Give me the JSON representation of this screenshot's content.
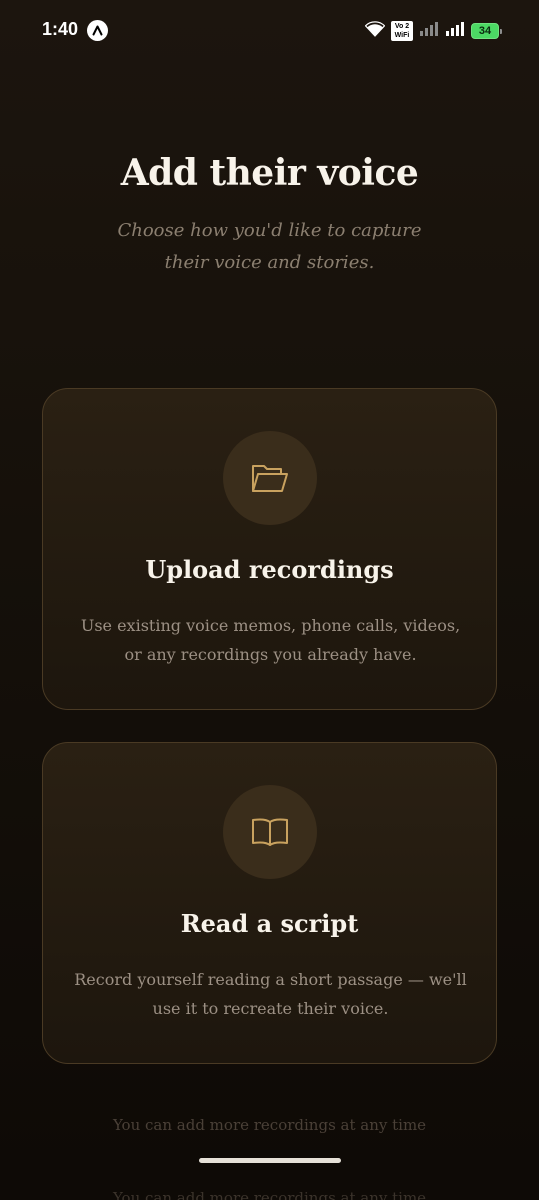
{
  "status_bar": {
    "time": "1:40",
    "volte_label_top": "Vo 2",
    "volte_label_bottom": "WiFi",
    "battery": "34"
  },
  "header": {
    "title": "Add their voice",
    "subtitle": "Choose how you'd like to capture their voice and stories."
  },
  "options": [
    {
      "icon": "folder-open-icon",
      "title": "Upload recordings",
      "description": "Use existing voice memos, phone calls, videos, or any recordings you already have."
    },
    {
      "icon": "book-open-icon",
      "title": "Read a script",
      "description": "Record yourself reading a short passage — we'll use it to recreate their voice."
    }
  ],
  "footer": {
    "note": "You can add more recordings at any time",
    "note_repeat": "You can add more recordings at any time"
  },
  "colors": {
    "accent_gold": "#c9a25f",
    "background": "#15100a",
    "card_border": "#4a3a24"
  }
}
